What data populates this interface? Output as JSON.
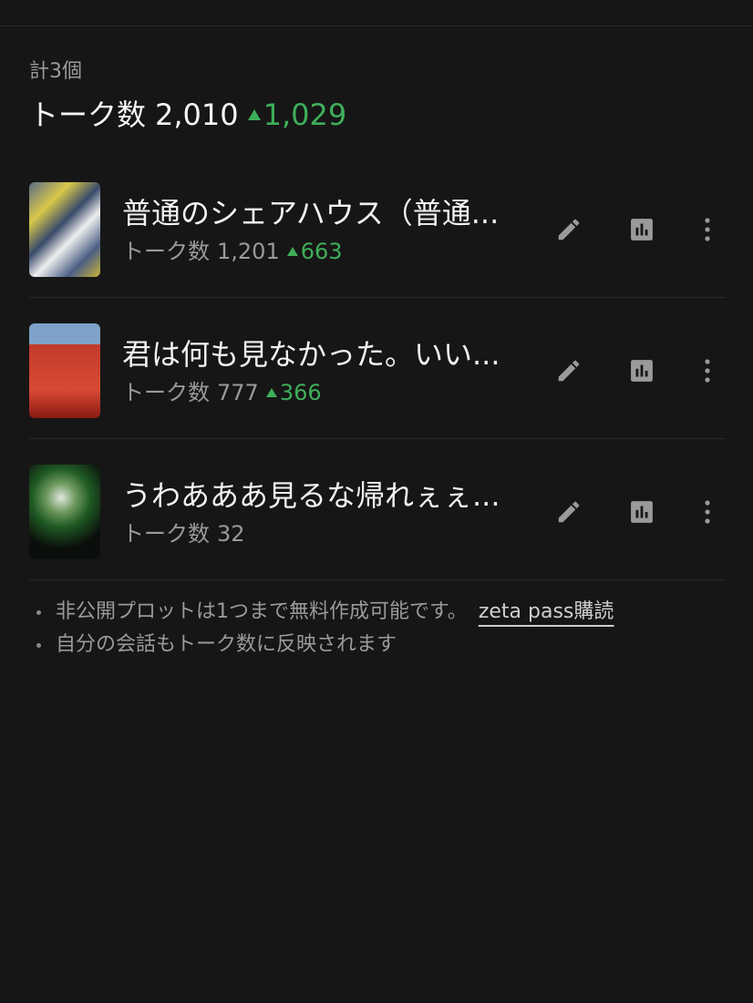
{
  "summary": {
    "count_label": "計3個",
    "total_label": "トーク数",
    "total_value": "2,010",
    "total_delta": "1,029"
  },
  "items": [
    {
      "title": "普通のシェアハウス（普通...",
      "talk_label": "トーク数",
      "talk_value": "1,201",
      "delta": "663"
    },
    {
      "title": "君は何も見なかった。いい...",
      "talk_label": "トーク数",
      "talk_value": "777",
      "delta": "366"
    },
    {
      "title": "うわあああ見るな帰れぇぇ...",
      "talk_label": "トーク数",
      "talk_value": "32",
      "delta": ""
    }
  ],
  "notes": {
    "line1": "非公開プロットは1つまで無料作成可能です。",
    "link": "zeta pass購読",
    "line2": "自分の会話もトーク数に反映されます"
  },
  "colors": {
    "background": "#161616",
    "accent_green": "#3fae5a",
    "muted": "#9a9a9a"
  },
  "icons": {
    "edit": "pencil-icon",
    "stats": "bar-chart-icon",
    "more": "more-vertical-icon"
  }
}
